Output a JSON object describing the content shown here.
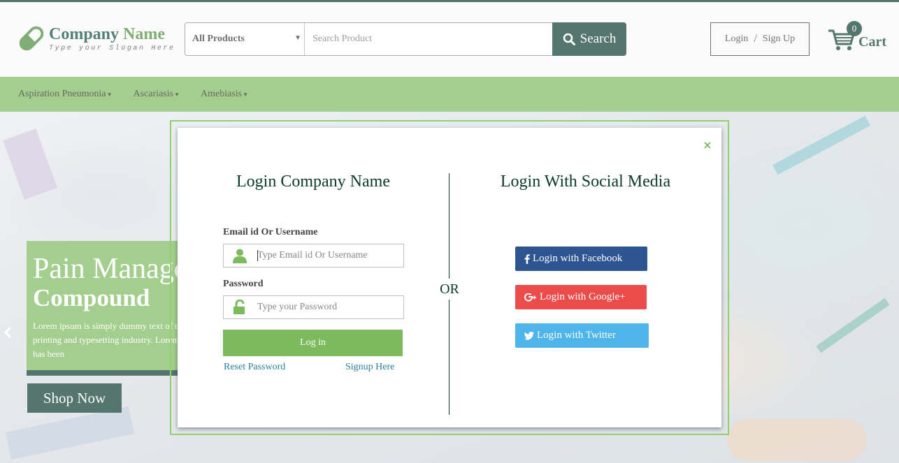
{
  "header": {
    "brand_name_1": "Company",
    "brand_name_2": "Name",
    "slogan": "Type your Slogan Here",
    "search": {
      "category": "All Products",
      "placeholder": "Search Product",
      "button_label": "Search"
    },
    "auth": {
      "login": "Login",
      "separator": "/",
      "signup": "Sign Up"
    },
    "cart": {
      "count": "0",
      "label": "Cart"
    }
  },
  "nav": {
    "items": [
      {
        "label": "Aspiration Pneumonia"
      },
      {
        "label": "Ascariasis"
      },
      {
        "label": "Amebiasis"
      }
    ]
  },
  "hero": {
    "title": "Pain Management",
    "subtitle": "Compound",
    "text": "Lorem ipsum is simply dummy text of the printing and typesetting industry. Lorem ipsum has been",
    "cta": "Shop Now"
  },
  "modal": {
    "close": "×",
    "login_title": "Login Company Name",
    "email_label": "Email id Or Username",
    "email_placeholder": "Type Email id Or Username",
    "password_label": "Password",
    "password_placeholder": "Type your Password",
    "login_button": "Log in",
    "reset_link": "Reset Password",
    "signup_link": "Signup Here",
    "or_text": "OR",
    "social_title": "Login With Social Media",
    "social": {
      "facebook": "Login with Facebook",
      "google": "Login with Google+",
      "twitter": "Login with Twitter"
    }
  },
  "colors": {
    "brand_dark": "#0c3b2e",
    "brand_green": "#7db95d",
    "facebook": "#2d5592",
    "google": "#ea4c4c",
    "twitter": "#4db5ea"
  }
}
